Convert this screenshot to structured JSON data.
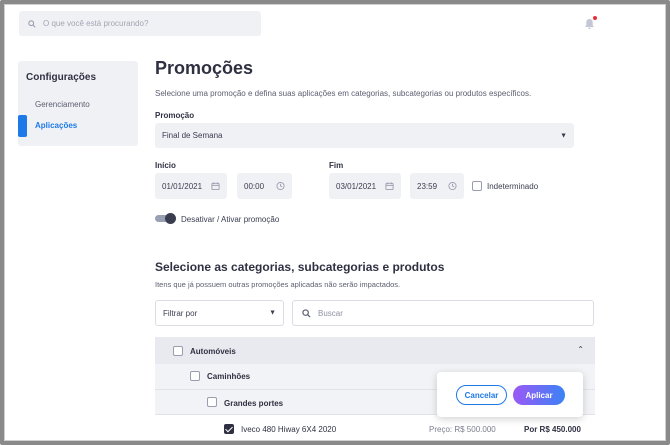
{
  "header": {
    "search_placeholder": "O que você está procurando?",
    "notification_color": "#e8313b"
  },
  "sidebar": {
    "title": "Configurações",
    "items": [
      {
        "label": "Gerenciamento",
        "active": false
      },
      {
        "label": "Aplicações",
        "active": true
      }
    ],
    "accent": "#1e79e8"
  },
  "page": {
    "title": "Promoções",
    "subtitle": "Selecione uma promoção e defina suas aplicações em categorias, subcategorias ou produtos específicos."
  },
  "promotion": {
    "label": "Promoção",
    "selected": "Final de Semana"
  },
  "start": {
    "label": "Início",
    "date": "01/01/2021",
    "time": "00:00"
  },
  "end": {
    "label": "Fim",
    "date": "03/01/2021",
    "time": "23:59",
    "indeterminate_label": "Indeterminado",
    "indeterminate": false
  },
  "toggle": {
    "label": "Desativar / Ativar promoção",
    "on": true
  },
  "categories": {
    "title": "Selecione as categorias, subcategorias e produtos",
    "note": "Itens que já possuem outras promoções aplicadas não serão impactados.",
    "filter_selected": "Filtrar por",
    "search_placeholder": "Buscar",
    "tree": [
      {
        "label": "Automóveis",
        "level": 0,
        "checked": false
      },
      {
        "label": "Caminhões",
        "level": 1,
        "checked": false
      },
      {
        "label": "Grandes portes",
        "level": 2,
        "checked": false
      },
      {
        "label": "Iveco 480 Hiway 6X4 2020",
        "level": 3,
        "checked": true,
        "price": "Preço: R$ 500.000",
        "promo_price": "Por R$ 450.000"
      }
    ]
  },
  "actions": {
    "cancel": "Cancelar",
    "apply": "Aplicar"
  }
}
